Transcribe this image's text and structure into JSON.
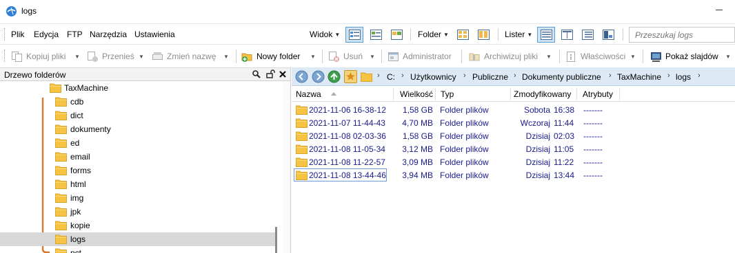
{
  "window": {
    "title": "logs"
  },
  "menu": {
    "items": [
      "Plik",
      "Edycja",
      "FTP",
      "Narzędzia",
      "Ustawienia"
    ],
    "widok_label": "Widok",
    "folder_label": "Folder",
    "lister_label": "Lister",
    "search_placeholder": "Przeszukaj logs"
  },
  "toolbar": {
    "copy": "Kopiuj pliki",
    "move": "Przenieś",
    "rename": "Zmień nazwę",
    "new_folder": "Nowy folder",
    "delete": "Usuń",
    "admin": "Administrator",
    "archive": "Archiwizuj pliki",
    "properties": "Właściwości",
    "slideshow": "Pokaż slajdów"
  },
  "tree": {
    "title": "Drzewo folderów",
    "parent": "TaxMachine",
    "children": [
      "cdb",
      "dict",
      "dokumenty",
      "ed",
      "email",
      "forms",
      "html",
      "img",
      "jpk",
      "kopie",
      "logs",
      "pct"
    ],
    "selected": "logs"
  },
  "address": {
    "crumbs": [
      "C:",
      "Użytkownicy",
      "Publiczne",
      "Dokumenty publiczne",
      "TaxMachine",
      "logs"
    ]
  },
  "columns": {
    "name": "Nazwa",
    "size": "Wielkość",
    "type": "Typ",
    "modified": "Zmodyfikowany",
    "attributes": "Atrybuty"
  },
  "files": [
    {
      "name": "2021-11-06 16-38-12",
      "size": "1,58 GB",
      "type": "Folder plików",
      "day": "Sobota",
      "time": "16:38",
      "attr": "-------"
    },
    {
      "name": "2021-11-07 11-44-43",
      "size": "4,70 MB",
      "type": "Folder plików",
      "day": "Wczoraj",
      "time": "11:44",
      "attr": "-------"
    },
    {
      "name": "2021-11-08 02-03-36",
      "size": "1,58 GB",
      "type": "Folder plików",
      "day": "Dzisiaj",
      "time": "02:03",
      "attr": "-------"
    },
    {
      "name": "2021-11-08 11-05-34",
      "size": "3,12 MB",
      "type": "Folder plików",
      "day": "Dzisiaj",
      "time": "11:05",
      "attr": "-------"
    },
    {
      "name": "2021-11-08 11-22-57",
      "size": "3,09 MB",
      "type": "Folder plików",
      "day": "Dzisiaj",
      "time": "11:22",
      "attr": "-------"
    },
    {
      "name": "2021-11-08 13-44-46",
      "size": "3,94 MB",
      "type": "Folder plików",
      "day": "Dzisiaj",
      "time": "13:44",
      "attr": "-------"
    }
  ],
  "focused_file": "2021-11-08 13-44-46",
  "colors": {
    "accent_bg": "#cfe3f7",
    "address_bg": "#ddeaf6",
    "folder_yellow": "#f6c342",
    "tree_line": "#d8782c",
    "file_text": "#1a1a8c",
    "selected_row": "#d9d9d9"
  },
  "icons": {
    "app": "xyplorer-globe-icon",
    "folder": "folder-icon"
  }
}
